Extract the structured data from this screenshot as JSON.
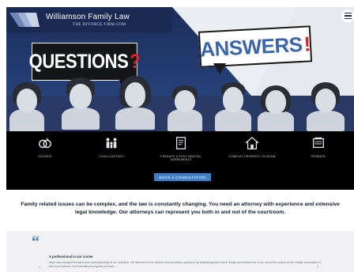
{
  "header": {
    "firm_name": "Williamson Family Law",
    "firm_url": "THE DIVORCE FIRM.COM"
  },
  "hero": {
    "questions_word": "QUESTIONS",
    "questions_mark": "?",
    "answers_word": "ANSWERS",
    "answers_mark": "!"
  },
  "services": [
    {
      "label": "DIVORCE",
      "icon": "divorce-rings-icon"
    },
    {
      "label": "CHILD CUSTODY",
      "icon": "child-custody-family-icon"
    },
    {
      "label": "PRENUPS & POST MARITAL AGREEMENTS",
      "icon": "document-agreement-icon"
    },
    {
      "label": "COMPLEX PROPERTY DIVISION",
      "icon": "house-property-icon"
    },
    {
      "label": "PROBATE",
      "icon": "probate-document-icon"
    }
  ],
  "book_button": "BOOK A CONSULTATION",
  "intro_text": "Family related issues can be complex, and the law is constantly changing. You need an attorney with experience and extensive legal knowledge. Our attorneys can represent you both in and out of the courtroom.",
  "testimonial": {
    "quote_glyph": "“",
    "title": "A professional in our corner",
    "body": "Mark was straight forward and understanding of our position. He listened to our wishes and provided guidance by explaining that some things we insisted on to be out of the scope of the reality accessible to the court (hence, the formality during the process ...",
    "prev": "‹",
    "next": "›"
  },
  "colors": {
    "navy": "#1a2a52",
    "accent_blue": "#3f7fc8",
    "red": "#e31e24",
    "black": "#000000"
  }
}
